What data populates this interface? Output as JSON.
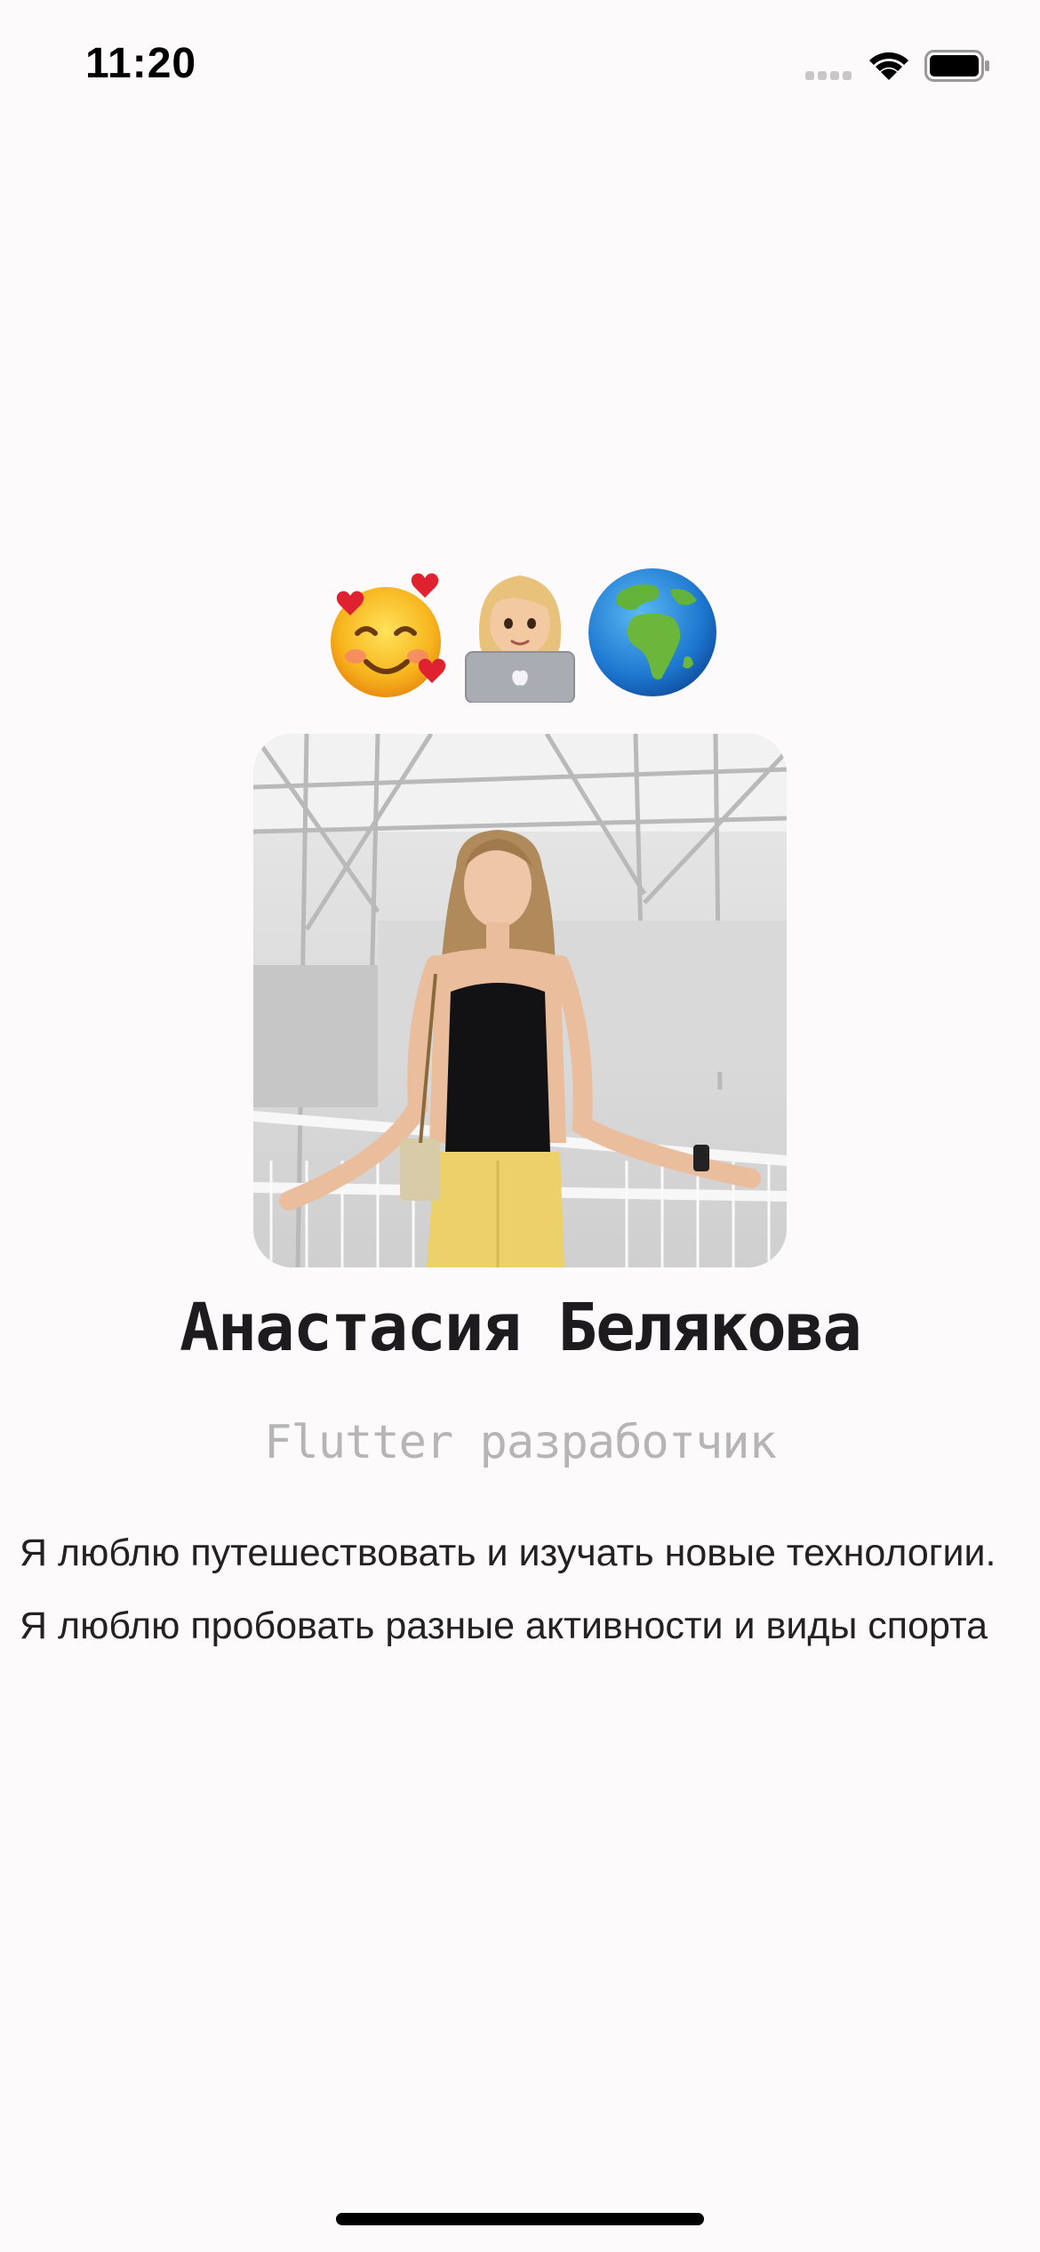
{
  "status_bar": {
    "time": "11:20",
    "signal_icon": "cellular-signal-icon",
    "wifi_icon": "wifi-icon",
    "battery_icon": "battery-icon"
  },
  "emojis": [
    {
      "name": "smiling-face-with-hearts",
      "symbol": "🥰"
    },
    {
      "name": "woman-technologist",
      "symbol": "👩‍💻"
    },
    {
      "name": "globe-europe-africa",
      "symbol": "🌍"
    }
  ],
  "profile": {
    "photo_icon": "profile-photo",
    "name": "Анастасия Белякова",
    "role": "Flutter разработчик",
    "bio": [
      "Я люблю путешествовать и изучать новые технологии.",
      "Я люблю пробовать разные активности и виды спорта"
    ]
  },
  "colors": {
    "background": "#fdfafc",
    "text_primary": "#1d1b1e",
    "text_secondary": "#b5b5b5"
  }
}
